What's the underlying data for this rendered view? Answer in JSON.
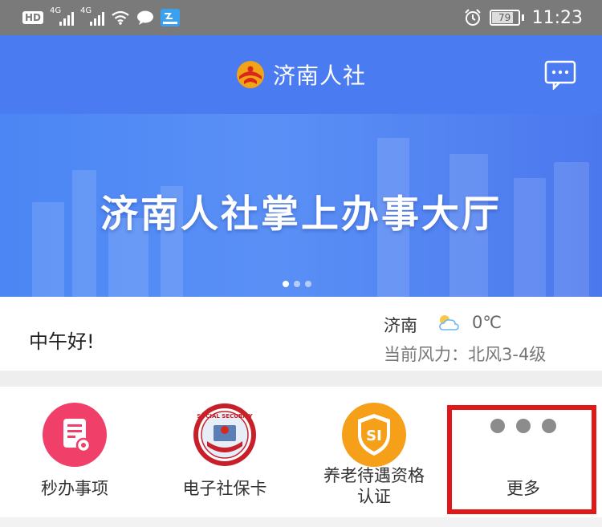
{
  "status_bar": {
    "hd": "HD",
    "sim1_type": "4G",
    "sim2_type": "4G",
    "battery": "79",
    "time": "11:23",
    "icons": [
      "hd-icon",
      "signal-icon",
      "wifi-icon",
      "chat-icon",
      "app-icon",
      "alarm-icon",
      "battery-icon"
    ]
  },
  "header": {
    "title": "济南人社",
    "message_icon": "message-icon"
  },
  "banner": {
    "title": "济南人社掌上办事大厅",
    "slides": 3,
    "active_slide": 1
  },
  "greeting": {
    "text": "中午好!",
    "city": "济南",
    "weather_icon": "partly-cloudy-icon",
    "temperature": "0℃",
    "wind": "当前风力：北风3-4级"
  },
  "services": [
    {
      "label": "秒办事项",
      "icon": "document-icon",
      "color": "#f0406a"
    },
    {
      "label": "电子社保卡",
      "icon": "social-security-card-icon",
      "color": "#c8202a"
    },
    {
      "label": "养老待遇资格认证",
      "label_line1": "养老待遇资格",
      "label_line2": "认证",
      "icon": "si-shield-icon",
      "color": "#f6a01a"
    },
    {
      "label": "更多",
      "icon": "more-dots-icon",
      "color": "#8c8c8c"
    }
  ],
  "colors": {
    "header_blue": "#4a7bf0",
    "highlight_red": "#e01818"
  }
}
